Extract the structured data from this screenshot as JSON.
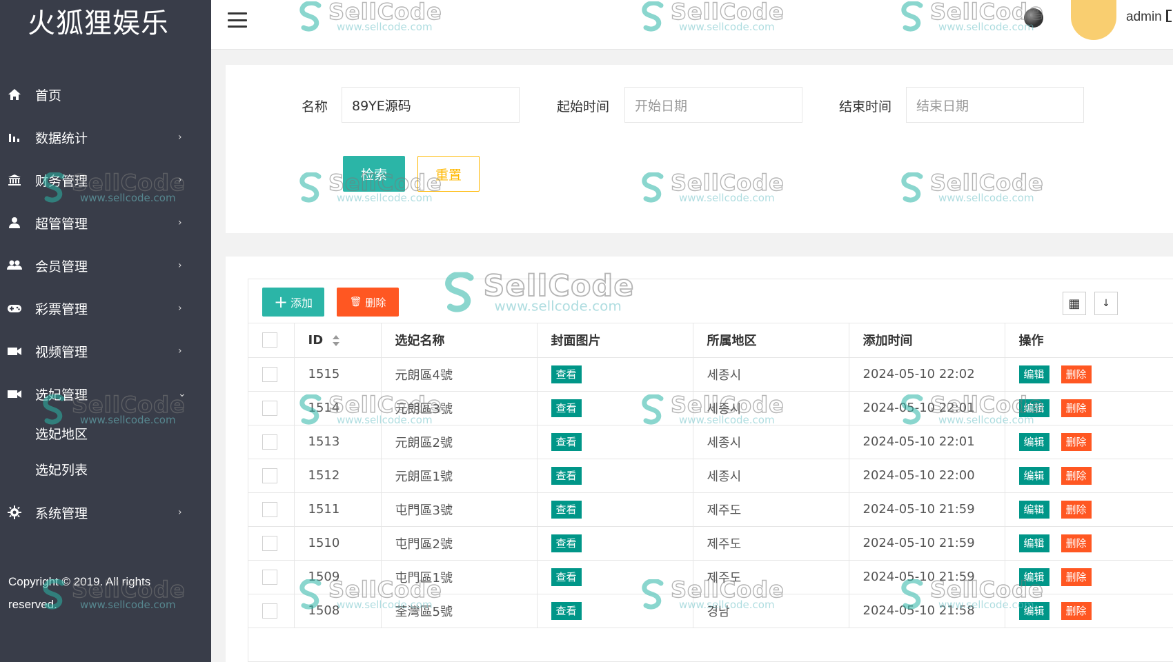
{
  "sidebar": {
    "brand": "火狐狸娱乐",
    "items": [
      {
        "label": "首页",
        "icon": "home-icon",
        "arrow": ""
      },
      {
        "label": "数据统计",
        "icon": "bar-chart-icon",
        "arrow": "›"
      },
      {
        "label": "财务管理",
        "icon": "bank-icon",
        "arrow": "›"
      },
      {
        "label": "超管管理",
        "icon": "user-icon",
        "arrow": "›"
      },
      {
        "label": "会员管理",
        "icon": "users-icon",
        "arrow": "›"
      },
      {
        "label": "彩票管理",
        "icon": "gamepad-icon",
        "arrow": "›"
      },
      {
        "label": "视频管理",
        "icon": "video-icon",
        "arrow": "›"
      },
      {
        "label": "选妃管理",
        "icon": "video-icon",
        "arrow": "⌄"
      }
    ],
    "subitems": [
      "选妃地区",
      "选妃列表"
    ],
    "system": {
      "label": "系统管理",
      "icon": "gear-icon",
      "arrow": "›"
    },
    "copyright": "Copyright © 2019. All rights reserved."
  },
  "header": {
    "admin_name": "admin"
  },
  "search": {
    "name_label": "名称",
    "name_value": "89YE源码",
    "start_label": "起始时间",
    "start_placeholder": "开始日期",
    "end_label": "结束时间",
    "end_placeholder": "结束日期",
    "search_button": "检索",
    "reset_button": "重置"
  },
  "toolbar": {
    "add_label": "添加",
    "delete_label": "删除"
  },
  "table": {
    "columns": [
      "ID",
      "选妃名称",
      "封面图片",
      "所属地区",
      "添加时间",
      "操作"
    ],
    "view_label": "查看",
    "edit_label": "编辑",
    "delete_label": "删除",
    "rows": [
      {
        "id": "1515",
        "name": "元朗區4號",
        "region": "세종시",
        "time": "2024-05-10 22:02"
      },
      {
        "id": "1514",
        "name": "元朗區3號",
        "region": "세종시",
        "time": "2024-05-10 22:01"
      },
      {
        "id": "1513",
        "name": "元朗區2號",
        "region": "세종시",
        "time": "2024-05-10 22:01"
      },
      {
        "id": "1512",
        "name": "元朗區1號",
        "region": "세종시",
        "time": "2024-05-10 22:00"
      },
      {
        "id": "1511",
        "name": "屯門區3號",
        "region": "제주도",
        "time": "2024-05-10 21:59"
      },
      {
        "id": "1510",
        "name": "屯門區2號",
        "region": "제주도",
        "time": "2024-05-10 21:59"
      },
      {
        "id": "1509",
        "name": "屯門區1號",
        "region": "제주도",
        "time": "2024-05-10 21:59"
      },
      {
        "id": "1508",
        "name": "荃灣區5號",
        "region": "경남",
        "time": "2024-05-10 21:58"
      }
    ]
  },
  "watermark": {
    "text": "SellCode",
    "url": "www.sellcode.com"
  },
  "colors": {
    "sidebar_bg": "#393d49",
    "primary": "#2bb5a7",
    "danger": "#ff5722",
    "warn": "#ffb800"
  }
}
